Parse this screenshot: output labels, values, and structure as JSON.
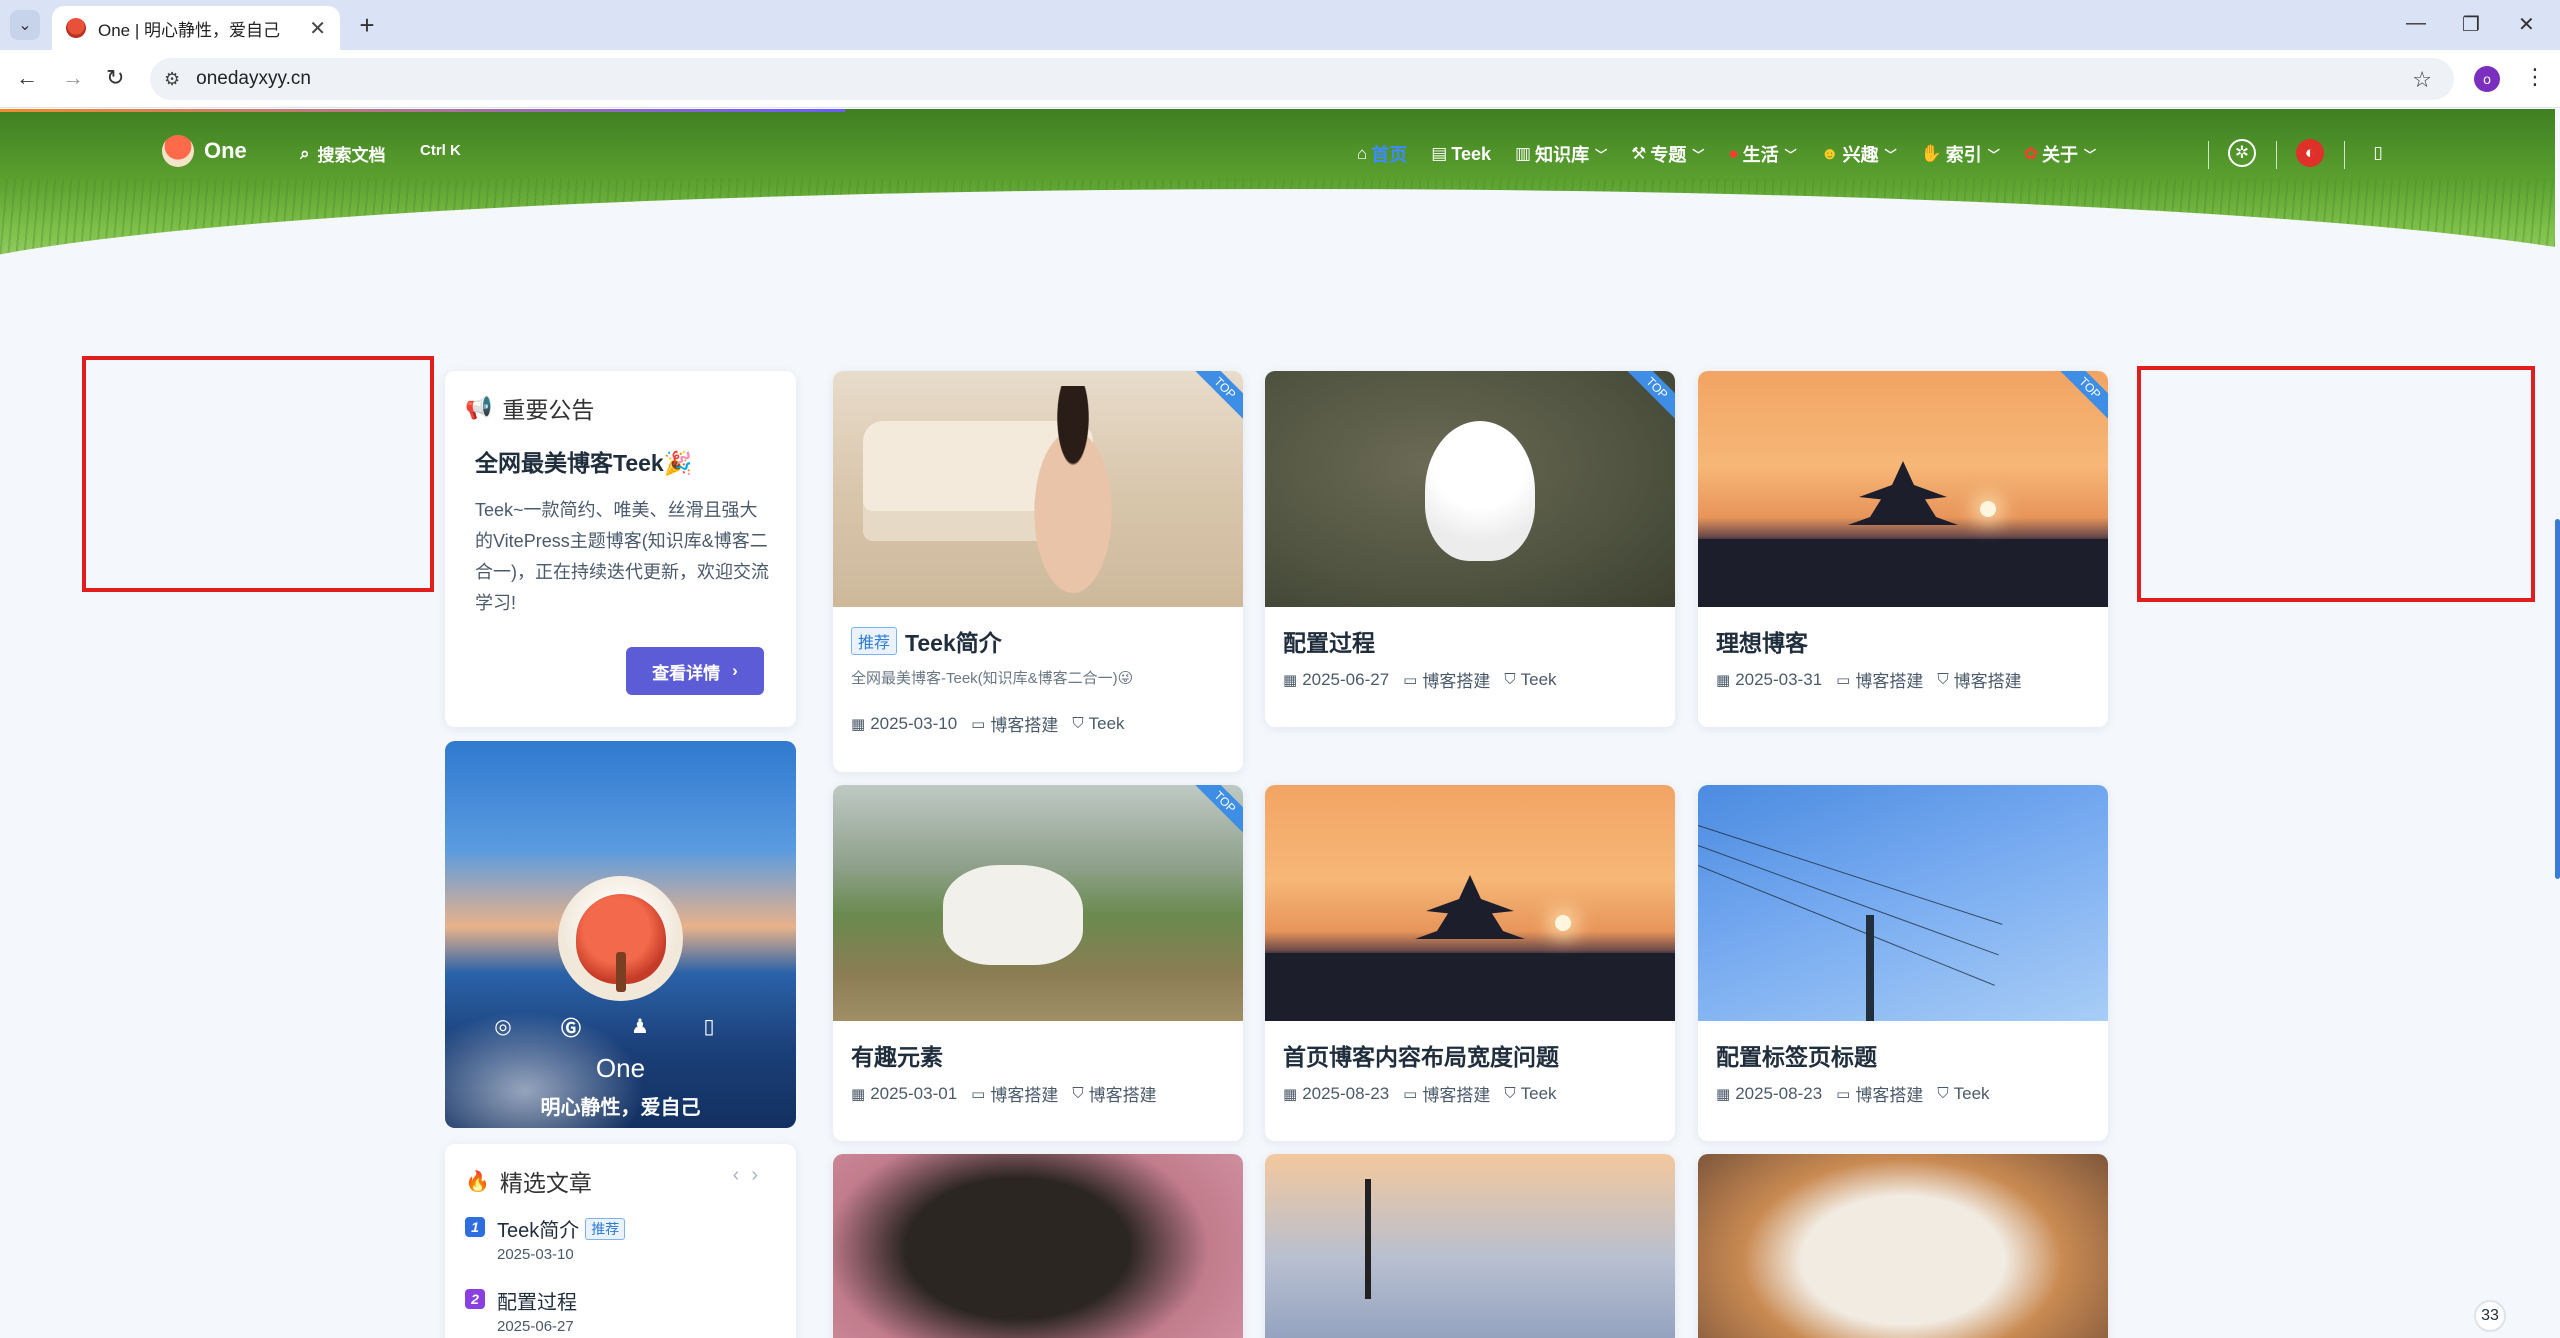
{
  "browser": {
    "tab_title": "One | 明心静性，爱自己",
    "url": "onedayxyy.cn",
    "profile_initial": "o",
    "tab_scroll_glyph": "⌄",
    "new_tab_glyph": "+",
    "close_glyph": "✕"
  },
  "site": {
    "brand": "One",
    "search_label": "搜索文档",
    "search_shortcut": "Ctrl K",
    "menu": [
      {
        "label": "首页",
        "icon": "home-icon",
        "has_caret": false,
        "active": true
      },
      {
        "label": "Teek",
        "icon": "doc-icon",
        "has_caret": false,
        "active": false
      },
      {
        "label": "知识库",
        "icon": "book-icon",
        "has_caret": true,
        "active": false
      },
      {
        "label": "专题",
        "icon": "tools-icon",
        "has_caret": true,
        "active": false
      },
      {
        "label": "生活",
        "icon": "balloon-icon",
        "has_caret": true,
        "active": false
      },
      {
        "label": "兴趣",
        "icon": "face-icon",
        "has_caret": true,
        "active": false
      },
      {
        "label": "索引",
        "icon": "hand-icon",
        "has_caret": true,
        "active": false
      },
      {
        "label": "关于",
        "icon": "rose-icon",
        "has_caret": true,
        "active": false
      }
    ]
  },
  "notice": {
    "title": "重要公告",
    "headline": "全网最美博客Teek🎉",
    "body": "Teek~一款简约、唯美、丝滑且强大的VitePress主题博客(知识库&博客二合一)，正在持续迭代更新，欢迎交流学习!",
    "button": "查看详情"
  },
  "profile": {
    "name": "One",
    "motto": "明心静性，爱自己"
  },
  "featured": {
    "title": "精选文章",
    "items": [
      {
        "num": "1",
        "name": "Teek简介",
        "tag": "推荐",
        "date": "2025-03-10",
        "color": "#2f6ee0"
      },
      {
        "num": "2",
        "name": "配置过程",
        "tag": "",
        "date": "2025-06-27",
        "color": "#8a3fe0"
      }
    ]
  },
  "posts": [
    {
      "title": "Teek简介",
      "badge": "推荐",
      "desc": "全网最美博客-Teek(知识库&博客二合一)😜",
      "date": "2025-03-10",
      "category": "博客搭建",
      "tag": "Teek",
      "top": "TOP"
    },
    {
      "title": "配置过程",
      "badge": "",
      "desc": "",
      "date": "2025-06-27",
      "category": "博客搭建",
      "tag": "Teek",
      "top": "TOP"
    },
    {
      "title": "理想博客",
      "badge": "",
      "desc": "",
      "date": "2025-03-31",
      "category": "博客搭建",
      "tag": "博客搭建",
      "top": "TOP"
    },
    {
      "title": "有趣元素",
      "badge": "",
      "desc": "",
      "date": "2025-03-01",
      "category": "博客搭建",
      "tag": "博客搭建",
      "top": "TOP"
    },
    {
      "title": "首页博客内容布局宽度问题",
      "badge": "",
      "desc": "",
      "date": "2025-08-23",
      "category": "博客搭建",
      "tag": "Teek",
      "top": ""
    },
    {
      "title": "配置标签页标题",
      "badge": "",
      "desc": "",
      "date": "2025-08-23",
      "category": "博客搭建",
      "tag": "Teek",
      "top": ""
    }
  ],
  "counter": "33",
  "colors": {
    "accent": "#5b5cd6",
    "annotation_box": "#e11d1d",
    "active_nav": "#3d8cff"
  }
}
